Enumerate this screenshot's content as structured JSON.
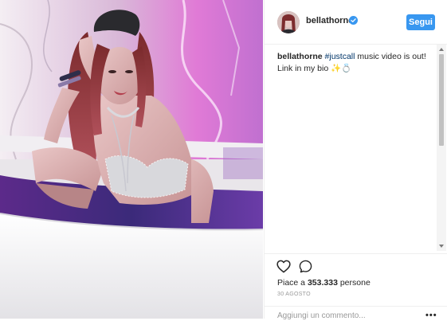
{
  "post": {
    "username": "bellathorne",
    "follow_label": "Segui",
    "caption": {
      "username": "bellathorne",
      "hashtag": "#justcall",
      "text": " music video is out! Link in my bio ✨💍"
    },
    "likes_prefix": "Piace a ",
    "likes_count": "353.333",
    "likes_suffix": " persone",
    "date": "30 AGOSTO",
    "comment_placeholder": "Aggiungi un commento...",
    "more_label": "•••"
  },
  "icons": {
    "verified": "verified-badge-icon",
    "like": "heart-icon",
    "comment": "comment-bubble-icon",
    "more": "ellipsis-icon"
  },
  "colors": {
    "follow_button": "#3897f0",
    "hashtag": "#003569",
    "verified": "#3897f0",
    "meta_text": "#999999"
  }
}
